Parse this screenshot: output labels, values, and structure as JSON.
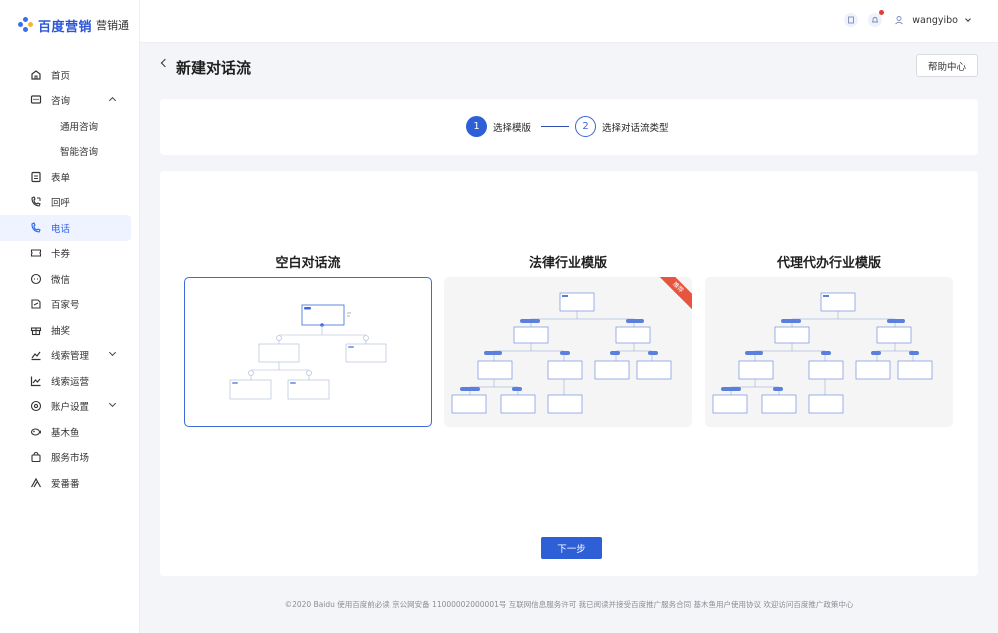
{
  "logo": {
    "brand": "百度营销",
    "product": "营销通"
  },
  "sidebar": {
    "items": [
      {
        "label": "首页",
        "icon": "home-icon"
      },
      {
        "label": "咨询",
        "icon": "chat-icon",
        "expanded": true
      },
      {
        "label": "通用咨询",
        "sub": true
      },
      {
        "label": "智能咨询",
        "sub": true
      },
      {
        "label": "表单",
        "icon": "form-icon"
      },
      {
        "label": "回呼",
        "icon": "callback-icon"
      },
      {
        "label": "电话",
        "icon": "phone-icon",
        "active": true
      },
      {
        "label": "卡券",
        "icon": "coupon-icon"
      },
      {
        "label": "微信",
        "icon": "wechat-icon"
      },
      {
        "label": "百家号",
        "icon": "baijiahao-icon"
      },
      {
        "label": "抽奖",
        "icon": "gift-icon"
      },
      {
        "label": "线索管理",
        "icon": "lead-manage-icon",
        "expandable": true
      },
      {
        "label": "线索运营",
        "icon": "lead-ops-icon"
      },
      {
        "label": "账户设置",
        "icon": "settings-icon",
        "expandable": true
      },
      {
        "label": "基木鱼",
        "icon": "fish-icon"
      },
      {
        "label": "服务市场",
        "icon": "market-icon"
      },
      {
        "label": "爱番番",
        "icon": "aifanfan-icon"
      }
    ]
  },
  "topbar": {
    "username": "wangyibo"
  },
  "page": {
    "title": "新建对话流",
    "help_label": "帮助中心"
  },
  "steps": [
    {
      "num": "1",
      "label": "选择模版"
    },
    {
      "num": "2",
      "label": "选择对话流类型"
    }
  ],
  "templates": [
    {
      "title": "空白对话流",
      "selected": true
    },
    {
      "title": "法律行业模版",
      "badge": "推荐"
    },
    {
      "title": "代理代办行业模版"
    }
  ],
  "next_label": "下一步",
  "footer": "©2020 Baidu 使用百度前必读 京公网安备 11000002000001号 互联网信息服务许可 我已阅读并接受百度推广服务合同 基木鱼用户使用协议 欢迎访问百度推广政策中心",
  "colors": {
    "primary": "#2f5fd7",
    "active_bg": "#eef3ff",
    "badge": "#e8553e"
  }
}
